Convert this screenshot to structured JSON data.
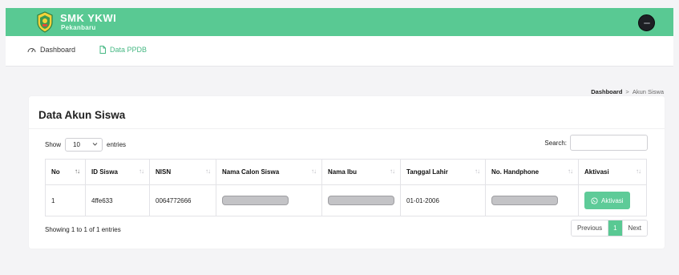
{
  "brand": {
    "title": "SMK YKWI",
    "subtitle": "Pekanbaru",
    "accent": "#59c993"
  },
  "nav": {
    "dashboard": "Dashboard",
    "data_ppdb": "Data PPDB"
  },
  "breadcrumb": {
    "home": "Dashboard",
    "separator": ">",
    "current": "Akun Siswa"
  },
  "card": {
    "title": "Data Akun Siswa",
    "show_label": "Show",
    "entries_value": "10",
    "entries_label": "entries",
    "search_label": "Search:",
    "search_value": ""
  },
  "table": {
    "columns": [
      "No",
      "ID Siswa",
      "NISN",
      "Nama Calon Siswa",
      "Nama Ibu",
      "Tanggal Lahir",
      "No. Handphone",
      "Aktivasi"
    ],
    "rows": [
      {
        "no": "1",
        "id_siswa": "4ffe633",
        "nisn": "0064772666",
        "nama_calon_siswa": "",
        "nama_ibu": "",
        "tanggal_lahir": "01-01-2006",
        "no_handphone": "",
        "aktivasi": "Aktivasi"
      }
    ]
  },
  "footer": {
    "info": "Showing 1 to 1 of 1 entries",
    "previous": "Previous",
    "page": "1",
    "next": "Next"
  }
}
